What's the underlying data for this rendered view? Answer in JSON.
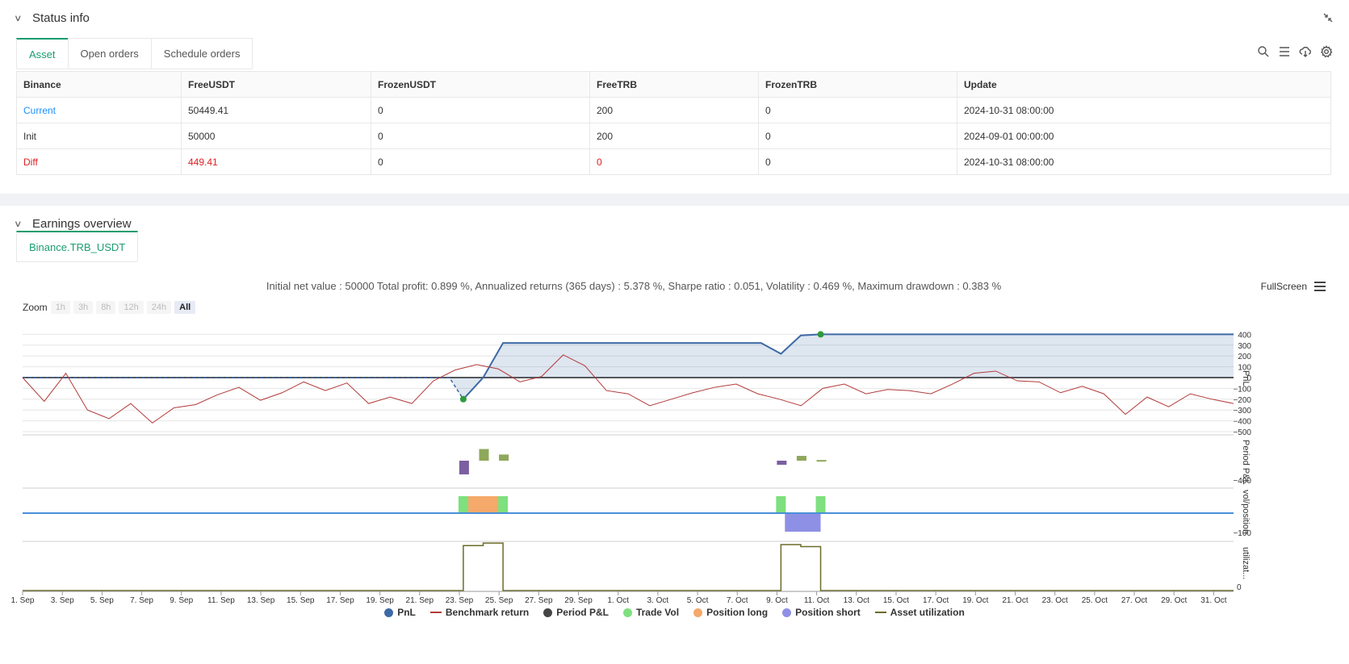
{
  "status": {
    "title": "Status info",
    "tabs": [
      "Asset",
      "Open orders",
      "Schedule orders"
    ],
    "table": {
      "headers": [
        "Binance",
        "FreeUSDT",
        "FrozenUSDT",
        "FreeTRB",
        "FrozenTRB",
        "Update"
      ],
      "rows": [
        [
          "Current",
          "50449.41",
          "0",
          "200",
          "0",
          "2024-10-31 08:00:00"
        ],
        [
          "Init",
          "50000",
          "0",
          "200",
          "0",
          "2024-09-01 00:00:00"
        ],
        [
          "Diff",
          "449.41",
          "0",
          "0",
          "0",
          "2024-10-31 08:00:00"
        ]
      ]
    }
  },
  "earnings": {
    "title": "Earnings overview",
    "tab": "Binance.TRB_USDT",
    "summary": "Initial net value : 50000 Total profit: 0.899 %, Annualized returns (365 days) : 5.378 %, Sharpe ratio : 0.051, Volatility : 0.469 %, Maximum drawdown : 0.383 %",
    "fullscreen": "FullScreen",
    "zoom_label": "Zoom",
    "zoom_options": [
      "1h",
      "3h",
      "8h",
      "12h",
      "24h",
      "All"
    ],
    "zoom_selected": "All"
  },
  "chart_data": {
    "type": "line",
    "x_ticks": [
      "1. Sep",
      "3. Sep",
      "5. Sep",
      "7. Sep",
      "9. Sep",
      "11. Sep",
      "13. Sep",
      "15. Sep",
      "17. Sep",
      "19. Sep",
      "21. Sep",
      "23. Sep",
      "25. Sep",
      "27. Sep",
      "29. Sep",
      "1. Oct",
      "3. Oct",
      "5. Oct",
      "7. Oct",
      "9. Oct",
      "11. Oct",
      "13. Oct",
      "15. Oct",
      "17. Oct",
      "19. Oct",
      "21. Oct",
      "23. Oct",
      "25. Oct",
      "27. Oct",
      "29. Oct",
      "31. Oct"
    ],
    "x_range_days": [
      0,
      61
    ],
    "panes": [
      {
        "ylabel": "PnL",
        "ticks": [
          "400",
          "300",
          "200",
          "100",
          "0",
          "−100",
          "−200",
          "−300",
          "−400",
          "−500"
        ],
        "ylim": [
          -500,
          420
        ]
      },
      {
        "ylabel": "Period P&L",
        "ticks": [
          "−400"
        ]
      },
      {
        "ylabel": "vol/position",
        "ticks": [
          "−100"
        ]
      },
      {
        "ylabel": "utilizat...",
        "ticks": [
          "0"
        ]
      }
    ],
    "series": [
      {
        "name": "PnL",
        "color": "#3d6aa5",
        "points": [
          [
            0,
            0
          ],
          [
            21.5,
            0
          ],
          [
            22.2,
            -200
          ],
          [
            23.2,
            0
          ],
          [
            24.2,
            320
          ],
          [
            37.2,
            320
          ],
          [
            38.2,
            220
          ],
          [
            39.2,
            390
          ],
          [
            40.2,
            400
          ],
          [
            61,
            400
          ]
        ]
      },
      {
        "name": "Benchmark return",
        "color": "#b33a3a",
        "values": [
          0,
          -220,
          40,
          -300,
          -380,
          -240,
          -420,
          -280,
          -250,
          -160,
          -90,
          -210,
          -140,
          -40,
          -120,
          -50,
          -240,
          -180,
          -240,
          -30,
          70,
          120,
          80,
          -40,
          10,
          210,
          110,
          -120,
          -150,
          -260,
          -200,
          -140,
          -90,
          -60,
          -150,
          -200,
          -260,
          -100,
          -60,
          -150,
          -110,
          -120,
          -150,
          -60,
          40,
          60,
          -30,
          -40,
          -140,
          -80,
          -150,
          -340,
          -180,
          -270,
          -150,
          -200,
          -240
        ]
      },
      {
        "name": "Period P&L",
        "color": "#8b9d4a",
        "bars": [
          [
            22.2,
            -200,
            "#7b5fa0"
          ],
          [
            23.2,
            170,
            "#8ea85a"
          ],
          [
            24.2,
            90,
            "#8ea85a"
          ],
          [
            38.2,
            -60,
            "#7b5fa0"
          ],
          [
            39.2,
            70,
            "#8ea85a"
          ],
          [
            40.2,
            10,
            "#8ea85a"
          ]
        ]
      },
      {
        "name": "Trade Vol",
        "color": "#7ee07e",
        "bars": [
          [
            22.2,
            200
          ],
          [
            24.2,
            200
          ],
          [
            38.2,
            200
          ],
          [
            40.2,
            200
          ]
        ]
      },
      {
        "name": "Position long",
        "color": "#f5a96b",
        "ranges": [
          [
            22.4,
            24.2,
            200
          ]
        ]
      },
      {
        "name": "Position short",
        "color": "#8e90e6",
        "ranges": [
          [
            38.4,
            40.2,
            -200
          ]
        ]
      },
      {
        "name": "Asset utilization",
        "color": "#6b6b2a",
        "steps": [
          [
            0,
            0
          ],
          [
            22.2,
            0
          ],
          [
            22.2,
            0.9
          ],
          [
            23.2,
            0.9
          ],
          [
            23.2,
            0.95
          ],
          [
            24.2,
            0.95
          ],
          [
            24.2,
            0
          ],
          [
            38.2,
            0
          ],
          [
            38.2,
            0.92
          ],
          [
            39.2,
            0.92
          ],
          [
            39.2,
            0.88
          ],
          [
            40.2,
            0.88
          ],
          [
            40.2,
            0
          ],
          [
            61,
            0
          ]
        ]
      }
    ],
    "markers": [
      {
        "x": 22.2,
        "y": -200,
        "color": "#2e9a3e"
      },
      {
        "x": 40.2,
        "y": 400,
        "color": "#2e9a3e"
      }
    ],
    "legend_position": "bottom-center",
    "grid": true
  }
}
